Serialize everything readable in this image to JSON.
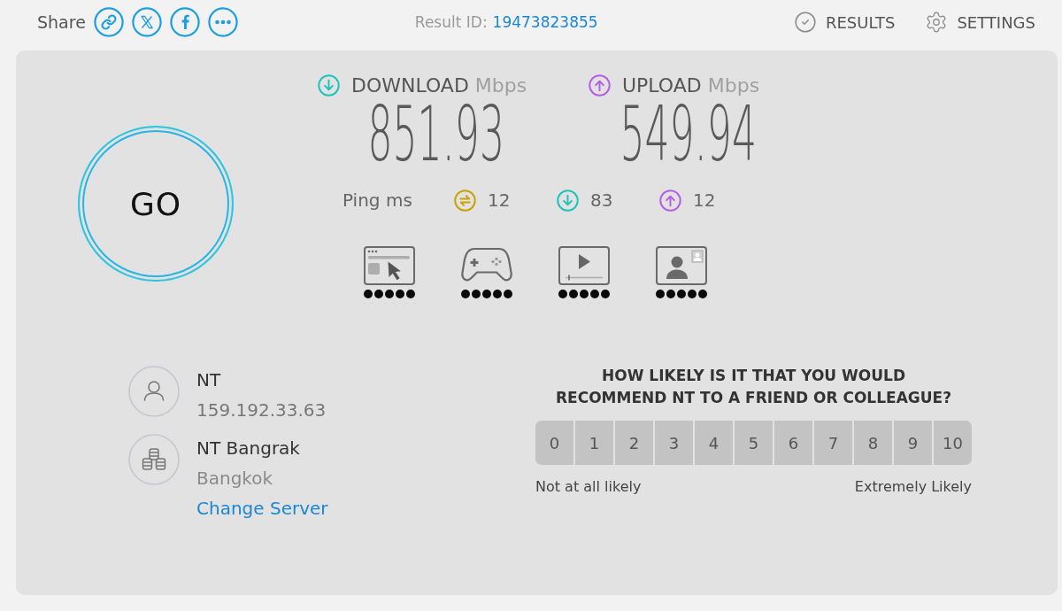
{
  "header": {
    "share_label": "Share",
    "result_id": {
      "label": "Result ID:",
      "value": "19473823855"
    },
    "nav": [
      {
        "label": "RESULTS"
      },
      {
        "label": "SETTINGS"
      }
    ]
  },
  "go_button": {
    "label": "GO"
  },
  "speeds": [
    {
      "kind": "download",
      "label": "DOWNLOAD",
      "unit": "Mbps",
      "value": "851.93"
    },
    {
      "kind": "upload",
      "label": "UPLOAD",
      "unit": "Mbps",
      "value": "549.94"
    }
  ],
  "ping": {
    "label": "Ping ms",
    "readings": [
      {
        "kind": "idle",
        "value": "12"
      },
      {
        "kind": "download",
        "value": "83"
      },
      {
        "kind": "upload",
        "value": "12"
      }
    ]
  },
  "activities": [
    {
      "stars": 5
    },
    {
      "stars": 5
    },
    {
      "stars": 5
    },
    {
      "stars": 5
    }
  ],
  "connection": {
    "provider": "NT",
    "ip": "159.192.33.63",
    "server": "NT Bangrak",
    "location": "Bangkok",
    "change_server": "Change Server"
  },
  "survey": {
    "question": "HOW LIKELY IS IT THAT YOU WOULD RECOMMEND NT TO A FRIEND OR COLLEAGUE?",
    "scale": [
      {
        "label": "0",
        "selected": false
      },
      {
        "label": "1",
        "selected": false
      },
      {
        "label": "2",
        "selected": false
      },
      {
        "label": "3",
        "selected": false
      },
      {
        "label": "4",
        "selected": false
      },
      {
        "label": "5",
        "selected": false
      },
      {
        "label": "6",
        "selected": false
      },
      {
        "label": "7",
        "selected": false
      },
      {
        "label": "8",
        "selected": false
      },
      {
        "label": "9",
        "selected": false
      },
      {
        "label": "10",
        "selected": false
      }
    ],
    "low_label": "Not at all likely",
    "high_label": "Extremely Likely"
  }
}
